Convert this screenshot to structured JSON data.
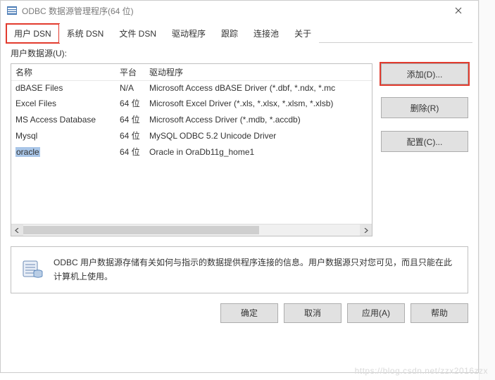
{
  "window": {
    "title": "ODBC 数据源管理程序(64 位)"
  },
  "tabs": [
    {
      "label": "用户 DSN",
      "active": true,
      "highlight": true
    },
    {
      "label": "系统 DSN",
      "active": false,
      "highlight": false
    },
    {
      "label": "文件 DSN",
      "active": false,
      "highlight": false
    },
    {
      "label": "驱动程序",
      "active": false,
      "highlight": false
    },
    {
      "label": "跟踪",
      "active": false,
      "highlight": false
    },
    {
      "label": "连接池",
      "active": false,
      "highlight": false
    },
    {
      "label": "关于",
      "active": false,
      "highlight": false
    }
  ],
  "section_label": "用户数据源(U):",
  "columns": {
    "name": "名称",
    "platform": "平台",
    "driver": "驱动程序"
  },
  "rows": [
    {
      "name": "dBASE Files",
      "platform": "N/A",
      "driver": "Microsoft Access dBASE Driver (*.dbf, *.ndx, *.mc"
    },
    {
      "name": "Excel Files",
      "platform": "64 位",
      "driver": "Microsoft Excel Driver (*.xls, *.xlsx, *.xlsm, *.xlsb)"
    },
    {
      "name": "MS Access Database",
      "platform": "64 位",
      "driver": "Microsoft Access Driver (*.mdb, *.accdb)"
    },
    {
      "name": "Mysql",
      "platform": "64 位",
      "driver": "MySQL ODBC 5.2 Unicode Driver"
    },
    {
      "name": "oracle",
      "platform": "64 位",
      "driver": "Oracle in OraDb11g_home1",
      "selected": true
    }
  ],
  "buttons": {
    "add": "添加(D)...",
    "delete": "删除(R)",
    "config": "配置(C)..."
  },
  "info_text": "ODBC 用户数据源存储有关如何与指示的数据提供程序连接的信息。用户数据源只对您可见，而且只能在此计算机上使用。",
  "bottom": {
    "ok": "确定",
    "cancel": "取消",
    "apply": "应用(A)",
    "help": "帮助"
  },
  "watermark": "https://blog.csdn.net/zzx2016zzx"
}
